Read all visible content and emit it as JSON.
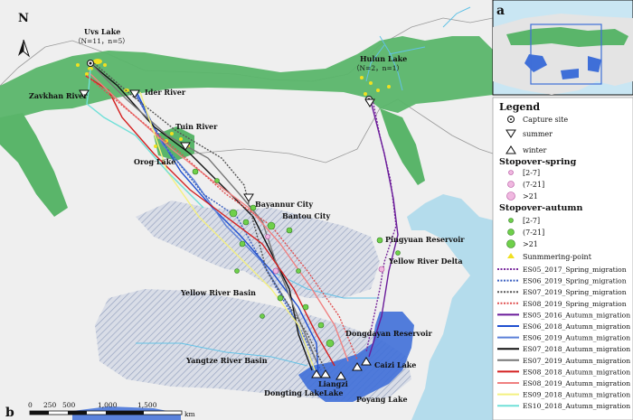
{
  "panel_a_label": "a",
  "panel_b_label": "b",
  "north": "N",
  "places": {
    "uvs": "Uvs Lake",
    "uvs_n": "（N=11，n=5）",
    "hulun": "Hulun Lake",
    "hulun_n": "（N=2，n=1）",
    "zavkhan": "Zavkhan River",
    "ider": "Ider River",
    "tuin": "Tuin River",
    "orog": "Orog Lake",
    "bayannur": "Bayannur City",
    "bantou": "Bantou City",
    "pingyuan": "Pingyuan Reservoir",
    "yrdelta": "Yellow River Delta",
    "yrbasin": "Yellow River Basin",
    "yzbasin": "Yangtze River Basin",
    "dongdayan": "Dongdayan Reservoir",
    "caizi": "Caizi Lake",
    "dongting": "Dongting Lake",
    "liangzi1": "Liangzi",
    "liangzi2": "Lake",
    "poyang": "Poyang Lake"
  },
  "scale": {
    "t0": "0",
    "t1": "250",
    "t2": "500",
    "t3": "1,000",
    "t4": "1,500",
    "unit": "km"
  },
  "legend": {
    "title": "Legend",
    "capture": "Capture site",
    "summer": "summer",
    "winter": "winter",
    "spring_head": "Stopover-spring",
    "s1": "[2-7]",
    "s2": "(7-21]",
    "s3": ">21",
    "autumn_head": "Stopover-autumn",
    "a1": "[2-7]",
    "a2": "(7-21]",
    "a3": ">21",
    "summering": "Sunmmering-point",
    "routes": [
      {
        "name": "ES05_2017_Spring_migration",
        "color": "#7a2a9c",
        "dash": true
      },
      {
        "name": "ES06_2019_Spring_migration",
        "color": "#3a5fc0",
        "dash": true
      },
      {
        "name": "ES07_2019_Spring_migration",
        "color": "#555555",
        "dash": true
      },
      {
        "name": "ES08_2019_Spring_migration",
        "color": "#e05050",
        "dash": true
      },
      {
        "name": "ES05_2016_Autumn_migration",
        "color": "#6a1b9a",
        "dash": false
      },
      {
        "name": "ES06_2018_Autumn_migration",
        "color": "#1f4fd0",
        "dash": false
      },
      {
        "name": "ES06_2019_Autumn_migration",
        "color": "#5a7fd8",
        "dash": false
      },
      {
        "name": "ES07_2018_Autumn_migration",
        "color": "#111111",
        "dash": false
      },
      {
        "name": "ES07_2019_Autumn_migration",
        "color": "#777777",
        "dash": false
      },
      {
        "name": "ES08_2018_Autumn_migration",
        "color": "#d42020",
        "dash": false
      },
      {
        "name": "ES08_2019_Autumn_migration",
        "color": "#f08080",
        "dash": false
      },
      {
        "name": "ES09_2018_Autumn_migration",
        "color": "#f4f080",
        "dash": false
      },
      {
        "name": "ES10_2018_Autumn_migration",
        "color": "#70e0d8",
        "dash": false
      }
    ]
  },
  "colors": {
    "range": "#5ab56a",
    "basin": "#b8c4d8",
    "winter_water": "#3f6fd8",
    "sea": "#b4dcec",
    "land": "#efefef",
    "river": "#63c2e6"
  }
}
